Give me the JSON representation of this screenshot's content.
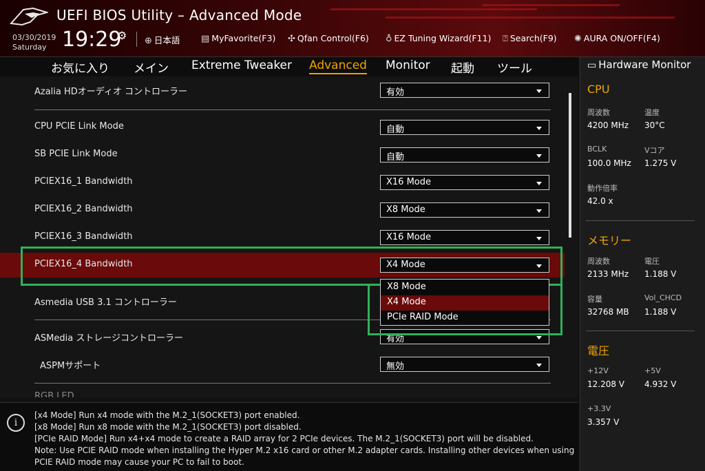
{
  "header": {
    "title": "UEFI BIOS Utility – Advanced Mode",
    "date": "03/30/2019",
    "day": "Saturday",
    "time": "19:29",
    "tools": [
      {
        "label": "日本語",
        "icon": "globe-icon"
      },
      {
        "label": "MyFavorite(F3)",
        "icon": "favorite-list-icon"
      },
      {
        "label": "Qfan Control(F6)",
        "icon": "fan-icon"
      },
      {
        "label": "EZ Tuning Wizard(F11)",
        "icon": "lightbulb-icon"
      },
      {
        "label": "Search(F9)",
        "icon": "search-help-icon"
      },
      {
        "label": "AURA ON/OFF(F4)",
        "icon": "aura-light-icon"
      }
    ]
  },
  "nav": {
    "items": [
      "お気に入り",
      "メイン",
      "Extreme Tweaker",
      "Advanced",
      "Monitor",
      "起動",
      "ツール"
    ],
    "active": "Advanced"
  },
  "settings": [
    {
      "label": "Azalia HDオーディオ コントローラー",
      "value": "有効"
    },
    {
      "label": "CPU PCIE Link Mode",
      "value": "自動"
    },
    {
      "label": "SB PCIE Link Mode",
      "value": "自動"
    },
    {
      "label": "PCIEX16_1 Bandwidth",
      "value": "X16 Mode"
    },
    {
      "label": "PCIEX16_2 Bandwidth",
      "value": "X8 Mode"
    },
    {
      "label": "PCIEX16_3 Bandwidth",
      "value": "X16 Mode"
    },
    {
      "label": "PCIEX16_4 Bandwidth",
      "value": "X4 Mode"
    },
    {
      "label": "Asmedia USB 3.1 コントローラー",
      "value": ""
    },
    {
      "label": "ASMedia ストレージコントローラー",
      "value": "有効"
    },
    {
      "label": "ASPMサポート",
      "value": "無効"
    },
    {
      "label": "RGB LED",
      "value": ""
    }
  ],
  "dropdown": {
    "options": [
      "X8 Mode",
      "X4 Mode",
      "PCIe RAID Mode"
    ],
    "selected": "X4 Mode"
  },
  "info": {
    "lines": [
      "[x4 Mode] Run x4 mode with the M.2_1(SOCKET3) port enabled.",
      "[x8 Mode] Run x8 mode with the M.2_1(SOCKET3) port disabled.",
      "[PCIe RAID Mode] Run x4+x4 mode to create a RAID array for 2 PCIe devices. The M.2_1(SOCKET3) port will be disabled.",
      "Note: Use PCIE RAID mode when installing the Hyper M.2 x16 card or other M.2 adapter cards. Installing other devices when using",
      "PCIE RAID mode may cause your PC to fail to boot."
    ]
  },
  "hardware_monitor": {
    "title": "Hardware Monitor",
    "cpu": {
      "heading": "CPU",
      "freq_label": "周波数",
      "freq": "4200 MHz",
      "temp_label": "温度",
      "temp": "30°C",
      "bclk_label": "BCLK",
      "bclk": "100.0 MHz",
      "vcore_label": "Vコア",
      "vcore": "1.275 V",
      "ratio_label": "動作倍率",
      "ratio": "42.0 x"
    },
    "memory": {
      "heading": "メモリー",
      "freq_label": "周波数",
      "freq": "2133 MHz",
      "volt_label": "電圧",
      "volt": "1.188 V",
      "cap_label": "容量",
      "cap": "32768 MB",
      "vol_chcd_label": "Vol_CHCD",
      "vol_chcd": "1.188 V"
    },
    "voltage": {
      "heading": "電圧",
      "v12_label": "+12V",
      "v12": "12.208 V",
      "v5_label": "+5V",
      "v5": "4.932 V",
      "v33_label": "+3.3V",
      "v33": "3.357 V"
    }
  }
}
